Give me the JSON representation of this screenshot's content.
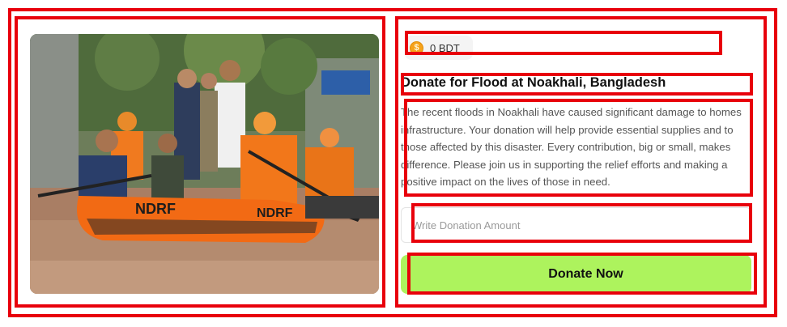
{
  "card": {
    "image_alt": "Rescue team in an orange inflatable boat on a flooded street",
    "balance": {
      "value": "0 BDT",
      "icon": "coin-icon"
    },
    "title": "Donate for Flood at Noakhali, Bangladesh",
    "description": "The recent floods in Noakhali have caused significant damage to homes  infrastructure. Your donation will help provide essential supplies and  to those affected by this disaster. Every contribution, big or small, makes  difference. Please join us in supporting the relief efforts and making a positive impact on the lives of those in need.",
    "donation_input": {
      "placeholder": "Write Donation Amount",
      "value": ""
    },
    "donate_button_label": "Donate Now"
  },
  "colors": {
    "annotation_red": "#e8000b",
    "button_green": "#adf35d",
    "coin_orange": "#f6a21a"
  }
}
